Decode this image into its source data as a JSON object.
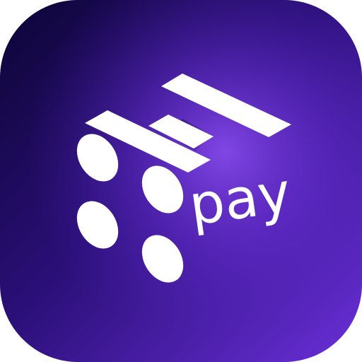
{
  "app_icon": {
    "logo_text": "Pay",
    "colors": {
      "background_dark": "#0c0535",
      "background_mid": "#3a1590",
      "background_light": "#7a3ee0",
      "mark": "#ffffff"
    },
    "icon_name": "hpay-logo-icon"
  }
}
